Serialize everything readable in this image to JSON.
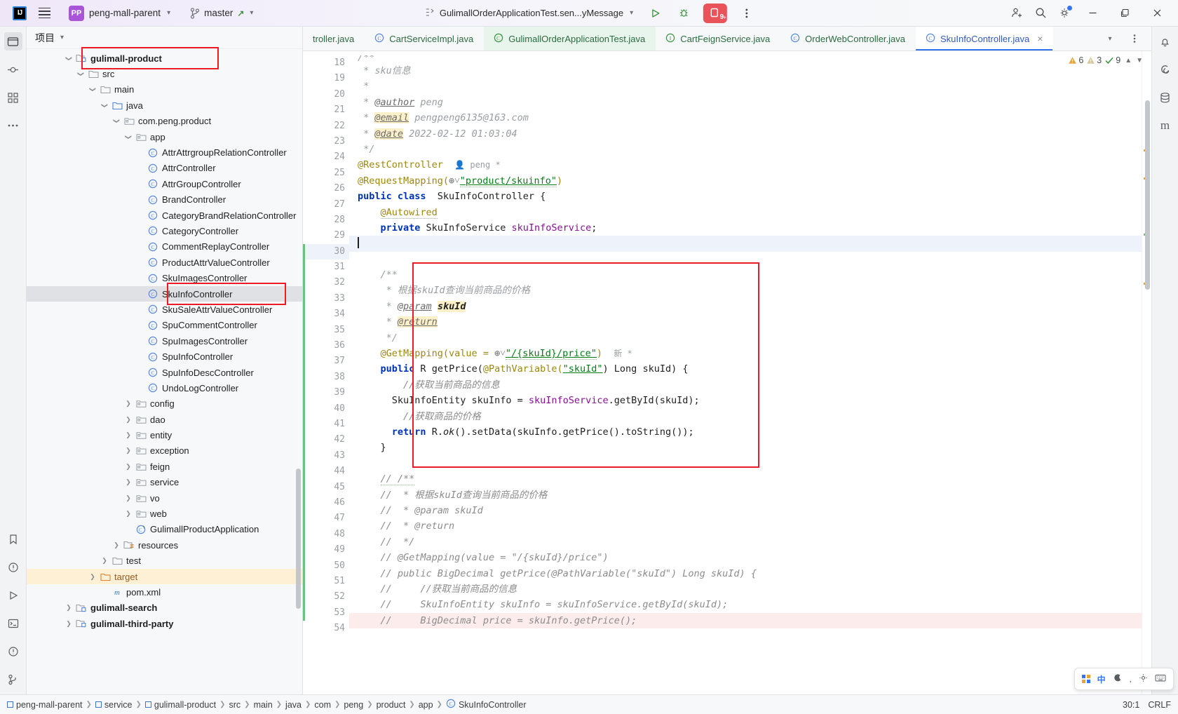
{
  "titlebar": {
    "logo": "IJ",
    "project_name": "peng-mall-parent",
    "branch": "master",
    "run_config": "GulimallOrderApplicationTest.sen...yMessage",
    "stop_count": "9",
    "icons": {
      "menu": "hamburger-icon",
      "run": "run-icon",
      "debug": "debug-icon",
      "more": "more-options-icon",
      "account": "add-account-icon",
      "search": "search-icon",
      "settings": "settings-gear-icon",
      "minimize": "minimize-icon",
      "maximize": "maximize-icon",
      "close": "close-icon"
    }
  },
  "project_panel": {
    "header": "项目",
    "tree": [
      {
        "indent": 1,
        "arrow": "v",
        "icon": "module",
        "label": "gulimall-product",
        "bold": true,
        "boxed": true
      },
      {
        "indent": 2,
        "arrow": "v",
        "icon": "folder",
        "label": "src"
      },
      {
        "indent": 3,
        "arrow": "v",
        "icon": "folder",
        "label": "main"
      },
      {
        "indent": 4,
        "arrow": "v",
        "icon": "folder-src",
        "label": "java"
      },
      {
        "indent": 5,
        "arrow": "v",
        "icon": "package",
        "label": "com.peng.product"
      },
      {
        "indent": 6,
        "arrow": "v",
        "icon": "package",
        "label": "app"
      },
      {
        "indent": 7,
        "arrow": "",
        "icon": "class",
        "label": "AttrAttrgroupRelationController"
      },
      {
        "indent": 7,
        "arrow": "",
        "icon": "class",
        "label": "AttrController"
      },
      {
        "indent": 7,
        "arrow": "",
        "icon": "class",
        "label": "AttrGroupController"
      },
      {
        "indent": 7,
        "arrow": "",
        "icon": "class",
        "label": "BrandController"
      },
      {
        "indent": 7,
        "arrow": "",
        "icon": "class",
        "label": "CategoryBrandRelationController"
      },
      {
        "indent": 7,
        "arrow": "",
        "icon": "class",
        "label": "CategoryController"
      },
      {
        "indent": 7,
        "arrow": "",
        "icon": "class",
        "label": "CommentReplayController"
      },
      {
        "indent": 7,
        "arrow": "",
        "icon": "class",
        "label": "ProductAttrValueController"
      },
      {
        "indent": 7,
        "arrow": "",
        "icon": "class",
        "label": "SkuImagesController"
      },
      {
        "indent": 7,
        "arrow": "",
        "icon": "class",
        "label": "SkuInfoController",
        "selected": true,
        "boxed2": true
      },
      {
        "indent": 7,
        "arrow": "",
        "icon": "class",
        "label": "SkuSaleAttrValueController"
      },
      {
        "indent": 7,
        "arrow": "",
        "icon": "class",
        "label": "SpuCommentController"
      },
      {
        "indent": 7,
        "arrow": "",
        "icon": "class",
        "label": "SpuImagesController"
      },
      {
        "indent": 7,
        "arrow": "",
        "icon": "class",
        "label": "SpuInfoController"
      },
      {
        "indent": 7,
        "arrow": "",
        "icon": "class",
        "label": "SpuInfoDescController"
      },
      {
        "indent": 7,
        "arrow": "",
        "icon": "class",
        "label": "UndoLogController"
      },
      {
        "indent": 6,
        "arrow": ">",
        "icon": "package",
        "label": "config"
      },
      {
        "indent": 6,
        "arrow": ">",
        "icon": "package",
        "label": "dao"
      },
      {
        "indent": 6,
        "arrow": ">",
        "icon": "package",
        "label": "entity"
      },
      {
        "indent": 6,
        "arrow": ">",
        "icon": "package",
        "label": "exception"
      },
      {
        "indent": 6,
        "arrow": ">",
        "icon": "package",
        "label": "feign"
      },
      {
        "indent": 6,
        "arrow": ">",
        "icon": "package",
        "label": "service"
      },
      {
        "indent": 6,
        "arrow": ">",
        "icon": "package",
        "label": "vo"
      },
      {
        "indent": 6,
        "arrow": ">",
        "icon": "package",
        "label": "web"
      },
      {
        "indent": 6,
        "arrow": "",
        "icon": "springclass",
        "label": "GulimallProductApplication"
      },
      {
        "indent": 5,
        "arrow": ">",
        "icon": "resources",
        "label": "resources"
      },
      {
        "indent": 4,
        "arrow": ">",
        "icon": "folder",
        "label": "test"
      },
      {
        "indent": 3,
        "arrow": ">",
        "icon": "folder-target",
        "label": "target",
        "yellow": true
      },
      {
        "indent": 4,
        "arrow": "",
        "icon": "maven",
        "label": "pom.xml"
      },
      {
        "indent": 1,
        "arrow": ">",
        "icon": "module",
        "label": "gulimall-search",
        "bold": true
      },
      {
        "indent": 1,
        "arrow": ">",
        "icon": "module",
        "label": "gulimall-third-party",
        "bold": true
      }
    ]
  },
  "editor_tabs": [
    {
      "label": "troller.java",
      "icon": "",
      "clipped": true
    },
    {
      "label": "CartServiceImpl.java",
      "icon": "class-icon"
    },
    {
      "label": "GulimallOrderApplicationTest.java",
      "icon": "test-class-icon",
      "green": true
    },
    {
      "label": "CartFeignService.java",
      "icon": "interface-icon"
    },
    {
      "label": "OrderWebController.java",
      "icon": "class-icon"
    },
    {
      "label": "SkuInfoController.java",
      "icon": "class-icon",
      "active": true,
      "blue": true
    }
  ],
  "inspections": {
    "errors": "6",
    "warnings": "3",
    "ok": "9"
  },
  "code": {
    "first_line": 18,
    "lines": [
      {
        "n": 18,
        "partial": true
      },
      {
        "n": 19
      },
      {
        "n": 20
      },
      {
        "n": 21
      },
      {
        "n": 22
      },
      {
        "n": 23
      },
      {
        "n": 24
      },
      {
        "n": 25,
        "gmark": "bean"
      },
      {
        "n": 26
      },
      {
        "n": 27,
        "gmark": "bean"
      },
      {
        "n": 28
      },
      {
        "n": 29,
        "gmark": "bean",
        "gmark2": "java"
      },
      {
        "n": 30,
        "current": true
      },
      {
        "n": 31
      },
      {
        "n": 32
      },
      {
        "n": 33
      },
      {
        "n": 34
      },
      {
        "n": 35
      },
      {
        "n": 36
      },
      {
        "n": 37
      },
      {
        "n": 38,
        "gmark": "web"
      },
      {
        "n": 39
      },
      {
        "n": 40
      },
      {
        "n": 41
      },
      {
        "n": 42
      },
      {
        "n": 43
      },
      {
        "n": 44
      },
      {
        "n": 45
      },
      {
        "n": 46
      },
      {
        "n": 47
      },
      {
        "n": 48
      },
      {
        "n": 49
      },
      {
        "n": 50
      },
      {
        "n": 51
      },
      {
        "n": 52
      },
      {
        "n": 53
      },
      {
        "n": 54
      }
    ],
    "text": {
      "l18": "/**",
      "l19_star": " * ",
      "l19": "sku信息",
      "l20": " *",
      "l21_tag": "@author",
      "l21_val": " peng",
      "l22_tag": "@email",
      "l22_val": " pengpeng6135@163.com",
      "l23_tag": "@date",
      "l23_val": " 2022-02-12 01:03:04",
      "l24": " */",
      "l25": "@RestController",
      "l25_hint": "peng *",
      "l26_a": "@RequestMapping(",
      "l26_str": "\"product/skuinfo\"",
      "l26_b": ")",
      "l27_kw": "public class",
      "l27_name": "  SkuInfoController {",
      "l28": "@Autowired",
      "l29_kw": "private",
      "l29_type": " SkuInfoService ",
      "l29_field": "skuInfoService",
      "l29_end": ";",
      "l32": "/**",
      "l33": " * 根据skuId查询当前商品的价格",
      "l34_tag": "@param",
      "l34_param": "skuId",
      "l35_tag": "@return",
      "l36": " */",
      "l37_a": "@GetMapping(value = ",
      "l37_str": "\"/{skuId}/price\"",
      "l37_b": ")",
      "l37_hint": "新 *",
      "l38_kw": "public",
      "l38_r": " R ",
      "l38_m": "getPrice(",
      "l38_ann": "@PathVariable(",
      "l38_str": "\"skuId\"",
      "l38_rest": ") Long skuId) {",
      "l39": "//获取当前商品的信息",
      "l40_a": "SkuInfoEntity skuInfo = ",
      "l40_svc": "skuInfoService",
      "l40_b": ".getById(skuId);",
      "l41": "//获取商品的价格",
      "l42_kw": "return",
      "l42_rest": " R.ok().setData(skuInfo.getPrice().toString());",
      "l43": "}",
      "l45": "// /**",
      "l46": "//  * 根据skuId查询当前商品的价格",
      "l47": "//  * @param skuId",
      "l48": "//  * @return",
      "l49": "//  */",
      "l50": "// @GetMapping(value = \"/{skuId}/price\")",
      "l51": "// public BigDecimal getPrice(@PathVariable(\"skuId\") Long skuId) {",
      "l52": "//     //获取当前商品的信息",
      "l53": "//     SkuInfoEntity skuInfo = skuInfoService.getById(skuId);",
      "l54_a": "//     ",
      "l54_b": "BigDecimal price = skuInfo.getPrice();"
    }
  },
  "statusbar": {
    "breadcrumbs": [
      {
        "label": "peng-mall-parent",
        "icon": "module-icon"
      },
      {
        "label": "service",
        "icon": "module-icon"
      },
      {
        "label": "gulimall-product",
        "icon": "module-icon"
      },
      {
        "label": "src",
        "icon": ""
      },
      {
        "label": "main",
        "icon": ""
      },
      {
        "label": "java",
        "icon": ""
      },
      {
        "label": "com",
        "icon": ""
      },
      {
        "label": "peng",
        "icon": ""
      },
      {
        "label": "product",
        "icon": ""
      },
      {
        "label": "app",
        "icon": ""
      },
      {
        "label": "SkuInfoController",
        "icon": "class-icon"
      }
    ],
    "caret_position": "30:1",
    "line_separator": "CRLF",
    "ime_label": "中"
  }
}
